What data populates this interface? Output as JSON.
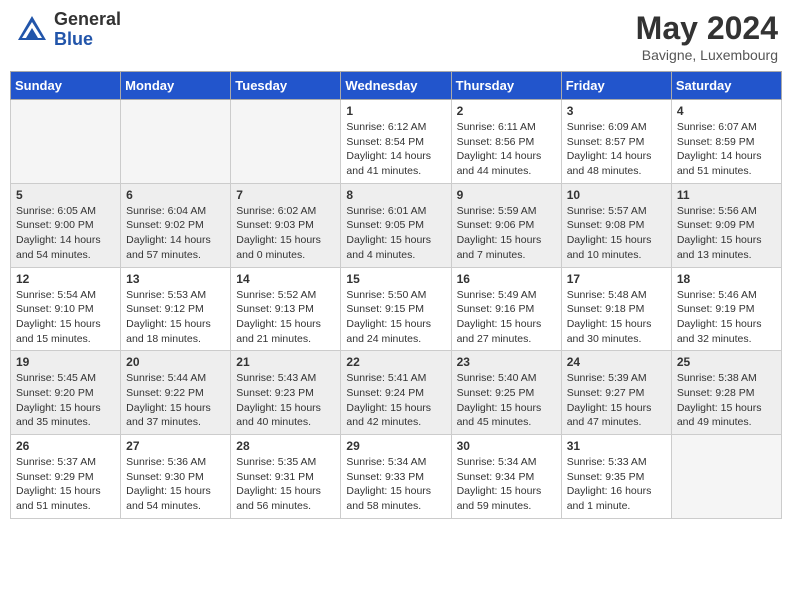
{
  "logo": {
    "general": "General",
    "blue": "Blue"
  },
  "title": "May 2024",
  "location": "Bavigne, Luxembourg",
  "days_of_week": [
    "Sunday",
    "Monday",
    "Tuesday",
    "Wednesday",
    "Thursday",
    "Friday",
    "Saturday"
  ],
  "weeks": [
    [
      {
        "day": "",
        "info": ""
      },
      {
        "day": "",
        "info": ""
      },
      {
        "day": "",
        "info": ""
      },
      {
        "day": "1",
        "info": "Sunrise: 6:12 AM\nSunset: 8:54 PM\nDaylight: 14 hours\nand 41 minutes."
      },
      {
        "day": "2",
        "info": "Sunrise: 6:11 AM\nSunset: 8:56 PM\nDaylight: 14 hours\nand 44 minutes."
      },
      {
        "day": "3",
        "info": "Sunrise: 6:09 AM\nSunset: 8:57 PM\nDaylight: 14 hours\nand 48 minutes."
      },
      {
        "day": "4",
        "info": "Sunrise: 6:07 AM\nSunset: 8:59 PM\nDaylight: 14 hours\nand 51 minutes."
      }
    ],
    [
      {
        "day": "5",
        "info": "Sunrise: 6:05 AM\nSunset: 9:00 PM\nDaylight: 14 hours\nand 54 minutes."
      },
      {
        "day": "6",
        "info": "Sunrise: 6:04 AM\nSunset: 9:02 PM\nDaylight: 14 hours\nand 57 minutes."
      },
      {
        "day": "7",
        "info": "Sunrise: 6:02 AM\nSunset: 9:03 PM\nDaylight: 15 hours\nand 0 minutes."
      },
      {
        "day": "8",
        "info": "Sunrise: 6:01 AM\nSunset: 9:05 PM\nDaylight: 15 hours\nand 4 minutes."
      },
      {
        "day": "9",
        "info": "Sunrise: 5:59 AM\nSunset: 9:06 PM\nDaylight: 15 hours\nand 7 minutes."
      },
      {
        "day": "10",
        "info": "Sunrise: 5:57 AM\nSunset: 9:08 PM\nDaylight: 15 hours\nand 10 minutes."
      },
      {
        "day": "11",
        "info": "Sunrise: 5:56 AM\nSunset: 9:09 PM\nDaylight: 15 hours\nand 13 minutes."
      }
    ],
    [
      {
        "day": "12",
        "info": "Sunrise: 5:54 AM\nSunset: 9:10 PM\nDaylight: 15 hours\nand 15 minutes."
      },
      {
        "day": "13",
        "info": "Sunrise: 5:53 AM\nSunset: 9:12 PM\nDaylight: 15 hours\nand 18 minutes."
      },
      {
        "day": "14",
        "info": "Sunrise: 5:52 AM\nSunset: 9:13 PM\nDaylight: 15 hours\nand 21 minutes."
      },
      {
        "day": "15",
        "info": "Sunrise: 5:50 AM\nSunset: 9:15 PM\nDaylight: 15 hours\nand 24 minutes."
      },
      {
        "day": "16",
        "info": "Sunrise: 5:49 AM\nSunset: 9:16 PM\nDaylight: 15 hours\nand 27 minutes."
      },
      {
        "day": "17",
        "info": "Sunrise: 5:48 AM\nSunset: 9:18 PM\nDaylight: 15 hours\nand 30 minutes."
      },
      {
        "day": "18",
        "info": "Sunrise: 5:46 AM\nSunset: 9:19 PM\nDaylight: 15 hours\nand 32 minutes."
      }
    ],
    [
      {
        "day": "19",
        "info": "Sunrise: 5:45 AM\nSunset: 9:20 PM\nDaylight: 15 hours\nand 35 minutes."
      },
      {
        "day": "20",
        "info": "Sunrise: 5:44 AM\nSunset: 9:22 PM\nDaylight: 15 hours\nand 37 minutes."
      },
      {
        "day": "21",
        "info": "Sunrise: 5:43 AM\nSunset: 9:23 PM\nDaylight: 15 hours\nand 40 minutes."
      },
      {
        "day": "22",
        "info": "Sunrise: 5:41 AM\nSunset: 9:24 PM\nDaylight: 15 hours\nand 42 minutes."
      },
      {
        "day": "23",
        "info": "Sunrise: 5:40 AM\nSunset: 9:25 PM\nDaylight: 15 hours\nand 45 minutes."
      },
      {
        "day": "24",
        "info": "Sunrise: 5:39 AM\nSunset: 9:27 PM\nDaylight: 15 hours\nand 47 minutes."
      },
      {
        "day": "25",
        "info": "Sunrise: 5:38 AM\nSunset: 9:28 PM\nDaylight: 15 hours\nand 49 minutes."
      }
    ],
    [
      {
        "day": "26",
        "info": "Sunrise: 5:37 AM\nSunset: 9:29 PM\nDaylight: 15 hours\nand 51 minutes."
      },
      {
        "day": "27",
        "info": "Sunrise: 5:36 AM\nSunset: 9:30 PM\nDaylight: 15 hours\nand 54 minutes."
      },
      {
        "day": "28",
        "info": "Sunrise: 5:35 AM\nSunset: 9:31 PM\nDaylight: 15 hours\nand 56 minutes."
      },
      {
        "day": "29",
        "info": "Sunrise: 5:34 AM\nSunset: 9:33 PM\nDaylight: 15 hours\nand 58 minutes."
      },
      {
        "day": "30",
        "info": "Sunrise: 5:34 AM\nSunset: 9:34 PM\nDaylight: 15 hours\nand 59 minutes."
      },
      {
        "day": "31",
        "info": "Sunrise: 5:33 AM\nSunset: 9:35 PM\nDaylight: 16 hours\nand 1 minute."
      },
      {
        "day": "",
        "info": ""
      }
    ]
  ]
}
